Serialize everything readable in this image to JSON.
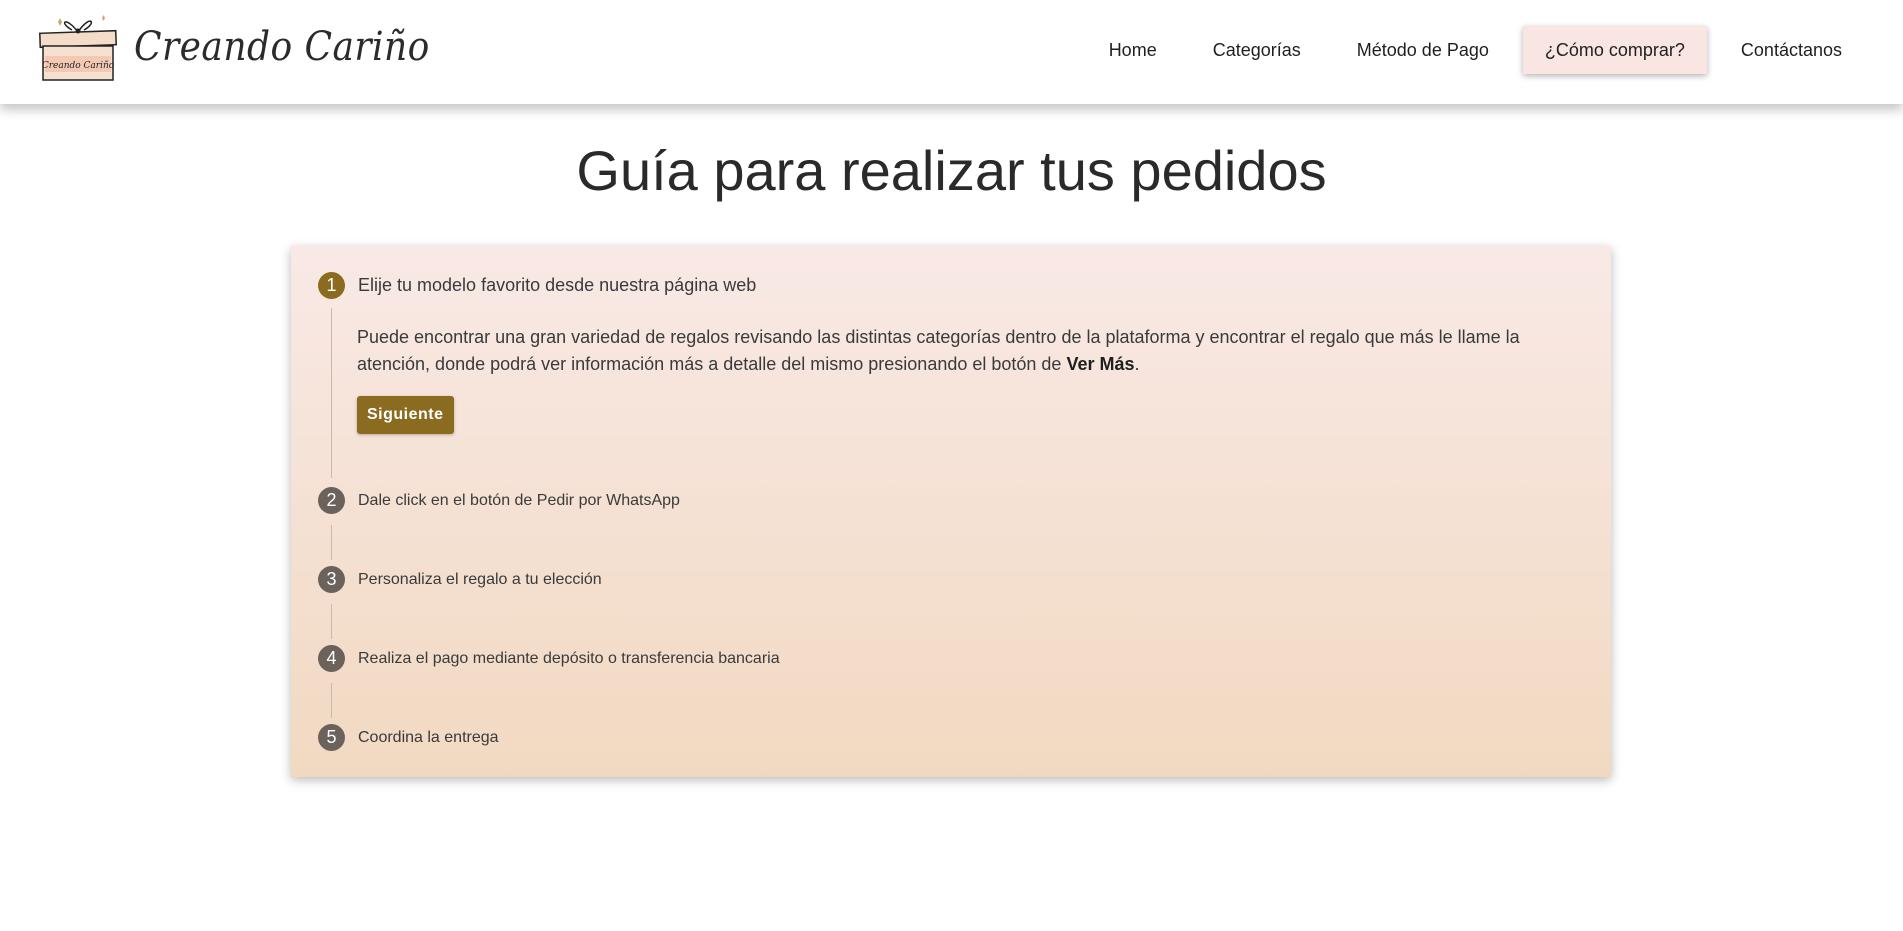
{
  "brand": {
    "name": "Creando Cariño",
    "logo_text": "Creando Cariño"
  },
  "nav": {
    "items": [
      {
        "label": "Home"
      },
      {
        "label": "Categorías"
      },
      {
        "label": "Método de Pago"
      },
      {
        "label": "¿Cómo comprar?",
        "active": true
      },
      {
        "label": "Contáctanos"
      }
    ]
  },
  "page": {
    "title": "Guía para realizar tus pedidos"
  },
  "steps": [
    {
      "number": "1",
      "title": "Elije tu modelo favorito desde nuestra página web",
      "active": true,
      "description_prefix": "Puede encontrar una gran variedad de regalos revisando las distintas categorías dentro de la plataforma y encontrar el regalo que más le llame la atención, donde podrá ver información más a detalle del mismo presionando el botón de ",
      "description_bold": "Ver Más",
      "description_suffix": ".",
      "button_label": "Siguiente"
    },
    {
      "number": "2",
      "title": "Dale click en el botón de Pedir por WhatsApp"
    },
    {
      "number": "3",
      "title": "Personaliza el regalo a tu elección"
    },
    {
      "number": "4",
      "title": "Realiza el pago mediante depósito o transferencia bancaria"
    },
    {
      "number": "5",
      "title": "Coordina la entrega"
    }
  ],
  "colors": {
    "accent": "#8b6b1f",
    "step_inactive": "#6b625c",
    "active_nav_bg": "#f9e6e2"
  }
}
